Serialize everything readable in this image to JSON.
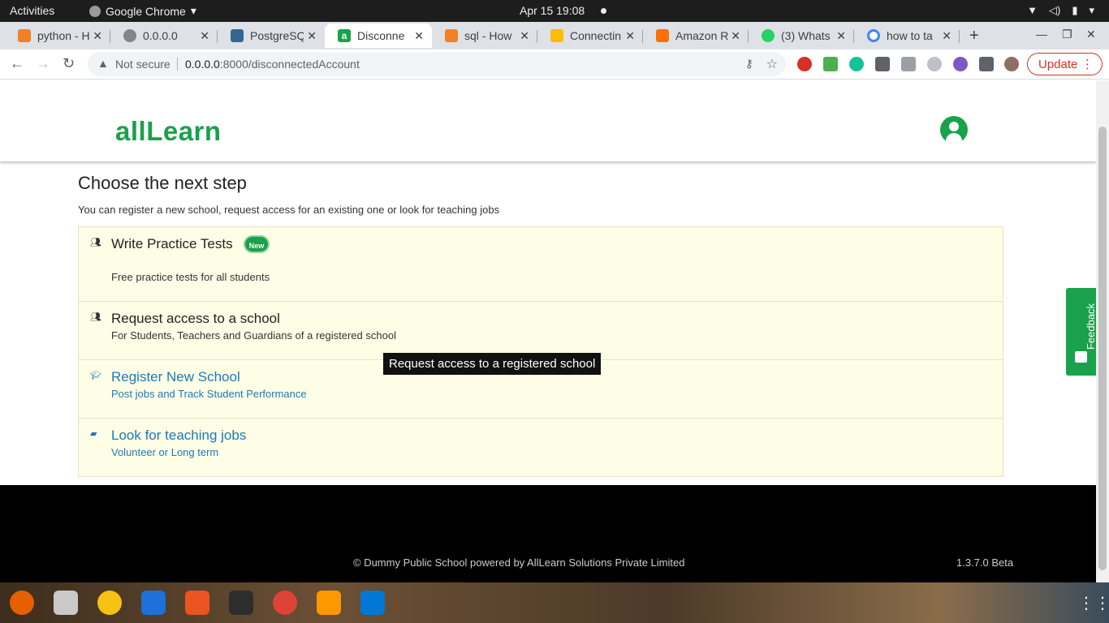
{
  "system_bar": {
    "activities": "Activities",
    "app_name": "Google Chrome",
    "clock": "Apr 15  19:08"
  },
  "browser": {
    "tabs": [
      {
        "title": "python - H",
        "favicon_color": "#f48024"
      },
      {
        "title": "0.0.0.0",
        "favicon_color": "#80868b"
      },
      {
        "title": "PostgreSQ",
        "favicon_color": "#336791"
      },
      {
        "title": "Disconne",
        "favicon_color": "#1aa14b",
        "active": true
      },
      {
        "title": "sql - How",
        "favicon_color": "#f48024"
      },
      {
        "title": "Connectin",
        "favicon_color": "#fbbc04"
      },
      {
        "title": "Amazon R",
        "favicon_color": "#ff6f00"
      },
      {
        "title": "(3) Whats",
        "favicon_color": "#25d366"
      },
      {
        "title": "how to ta",
        "favicon_color": "#4285f4"
      }
    ],
    "security_label": "Not secure",
    "url_host": "0.0.0.0",
    "url_rest": ":8000/disconnectedAccount",
    "update_label": "Update"
  },
  "header": {
    "logo": "allLearn"
  },
  "main": {
    "title": "Choose the next step",
    "subtitle": "You can register a new school, request access for an existing one or look for teaching jobs",
    "options": [
      {
        "title": "Write Practice Tests",
        "badge": "New",
        "description": "Free practice tests for all students",
        "icon": "add-user-icon"
      },
      {
        "title": "Request access to a school",
        "description": "For Students, Teachers and Guardians of a registered school",
        "icon": "add-user-icon"
      },
      {
        "title": "Register New School",
        "description": "Post jobs and Track Student Performance",
        "icon": "graduation-cap-icon"
      },
      {
        "title": "Look for teaching jobs",
        "description": "Volunteer or Long term",
        "icon": "briefcase-icon"
      }
    ],
    "tooltip": "Request access to a registered school"
  },
  "feedback": {
    "label": "Feedback"
  },
  "footer": {
    "copyright": "© Dummy Public School powered by AllLearn Solutions Private Limited",
    "version": "1.3.7.0 Beta"
  },
  "colors": {
    "brand": "#1aa14b",
    "link": "#1a7ab9",
    "card_bg": "#fefee6"
  }
}
